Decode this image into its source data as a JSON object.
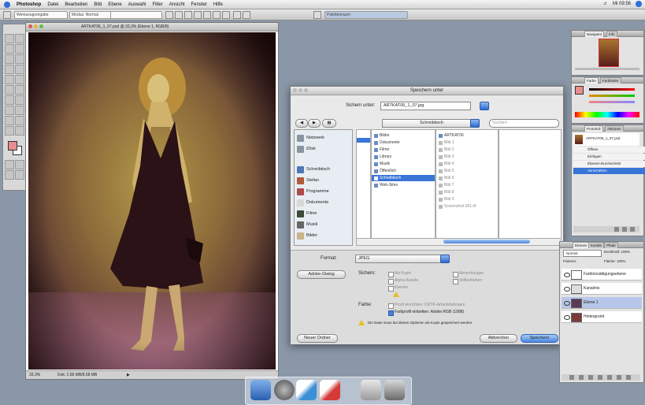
{
  "menubar": {
    "app": "Photoshop",
    "items": [
      "Datei",
      "Bearbeiten",
      "Bild",
      "Ebene",
      "Auswahl",
      "Filter",
      "Ansicht",
      "Fenster",
      "Hilfe"
    ],
    "clock": "Mi 09:56"
  },
  "options_bar": {
    "tool_preset": "Werkzeugvorgabe",
    "mode": "Modus: Normal",
    "right_field": "Palettenraum"
  },
  "document": {
    "title": "ARTKAT06_1_07.psd @ 33,3% (Ebene 1, RGB/8)",
    "zoom": "33,3%",
    "doc_size": "Dok: 2,85 MB/8,58 MB"
  },
  "dialog": {
    "title": "Speichern unter",
    "save_as_label": "Sichern unter:",
    "filename": "ARTKAT06_1_07.jpg",
    "location": "Schreibtisch",
    "search_placeholder": "Suchen",
    "sidebar": [
      {
        "label": "Netzwerk",
        "icon": "network-icon"
      },
      {
        "label": "iDisk",
        "icon": "idisk-icon"
      },
      {
        "label": "Schreibtisch",
        "icon": "desktop-icon"
      },
      {
        "label": "Stefan",
        "icon": "home-icon"
      },
      {
        "label": "Programme",
        "icon": "applications-icon"
      },
      {
        "label": "Dokumente",
        "icon": "documents-icon"
      },
      {
        "label": "Filme",
        "icon": "movies-icon"
      },
      {
        "label": "Musik",
        "icon": "music-icon"
      },
      {
        "label": "Bilder",
        "icon": "pictures-icon"
      }
    ],
    "column1": [
      "",
      "",
      "",
      "",
      "",
      "",
      "",
      ""
    ],
    "column2": [
      "Bilder",
      "Dokumente",
      "Filme",
      "Library",
      "Musik",
      "Öffentlich",
      "Schreibtisch",
      "Web-Sites"
    ],
    "column2_selected": 6,
    "column3": [
      "ARTKAT06",
      "Bild 1",
      "Bild 2",
      "Bild 3",
      "Bild 4",
      "Bild 5",
      "Bild 6",
      "Bild 7",
      "Bild 8",
      "Bild 9",
      "Screenshot 001.tif"
    ],
    "format_label": "Format:",
    "format_value": "JPEG",
    "adobe_dialog_button": "Adobe-Dialog",
    "save_label": "Sichern:",
    "as_copy": "Als Kopie",
    "alpha_channels": "Alpha-Kanäle",
    "layers": "Ebenen",
    "notes": "Anmerkungen",
    "spot_colors": "Volltonfarben",
    "color_label": "Farbe:",
    "proof_setup": "Proof einrichten: CMYK-Arbeitsfarbraum",
    "embed_profile": "Farbprofil einbetten: Adobe RGB (1998)",
    "warning_text": "Die Datei muss bei diesen Optionen als Kopie gespeichert werden.",
    "new_folder_button": "Neuer Ordner",
    "cancel_button": "Abbrechen",
    "save_button": "Speichern"
  },
  "palettes": {
    "navigator_tabs": [
      "Navigator",
      "Info"
    ],
    "color_tabs": [
      "Farbe",
      "Farbfelder"
    ],
    "history_tabs": [
      "Protokoll",
      "Aktionen"
    ],
    "history_items": [
      "ARTKAT06_1_07.psd",
      "Öffnen",
      "Einfügen",
      "Ebenen-Durchschnitt",
      "Verschieben"
    ],
    "layers_tabs": [
      "Ebenen",
      "Kanäle",
      "Pfade"
    ],
    "blend_mode": "Normal",
    "opacity": "Deckkraft: 100%",
    "fill": "Fläche: 100%",
    "lock_label": "Fixieren:",
    "layers": [
      "Farbtonsättigungsebene",
      "Kanalmix",
      "Ebene 1",
      "Hintergrund"
    ]
  },
  "colors": {
    "accent_blue": "#3875d7",
    "foreground_swatch": "#e88d8d",
    "dialog_gray": "#e9e9e9"
  }
}
